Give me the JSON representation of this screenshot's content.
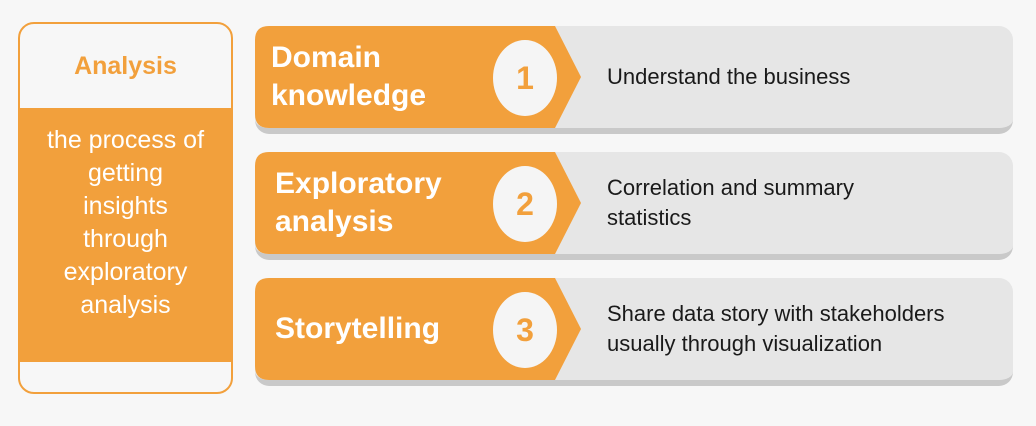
{
  "analysis": {
    "title": "Analysis",
    "description_lines": [
      "the process of",
      "getting",
      "insights",
      "through",
      "exploratory",
      "analysis"
    ]
  },
  "colors": {
    "accent": "#f2a03c",
    "row_background": "#e6e6e6",
    "text_dark": "#1a1a1a"
  },
  "steps": [
    {
      "number": "1",
      "title_lines": [
        "Domain",
        "knowledge"
      ],
      "description_lines": [
        "Understand the business"
      ]
    },
    {
      "number": "2",
      "title_lines": [
        "Exploratory",
        "analysis"
      ],
      "description_lines": [
        "Correlation and summary",
        "statistics"
      ]
    },
    {
      "number": "3",
      "title_lines": [
        "Storytelling"
      ],
      "description_lines": [
        "Share data story with stakeholders",
        "usually through visualization"
      ]
    }
  ]
}
